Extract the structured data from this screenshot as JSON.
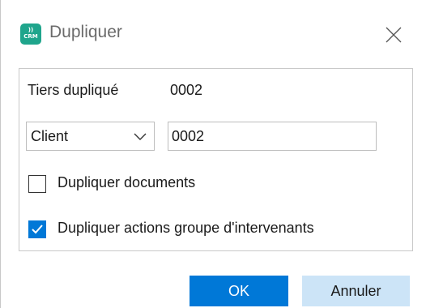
{
  "window": {
    "title": "Dupliquer",
    "app_icon_text": "CRM"
  },
  "form": {
    "tiers_label": "Tiers dupliqué",
    "tiers_value": "0002",
    "type_select": {
      "selected": "Client"
    },
    "code_input": {
      "value": "0002"
    },
    "dup_documents": {
      "label": "Dupliquer documents",
      "checked": false
    },
    "dup_actions": {
      "label": "Dupliquer actions groupe d'intervenants",
      "checked": true
    }
  },
  "buttons": {
    "ok_label": "OK",
    "cancel_label": "Annuler"
  },
  "colors": {
    "accent": "#0078d7",
    "secondary_button": "#cce4f7",
    "app_icon": "#1fa58c"
  }
}
